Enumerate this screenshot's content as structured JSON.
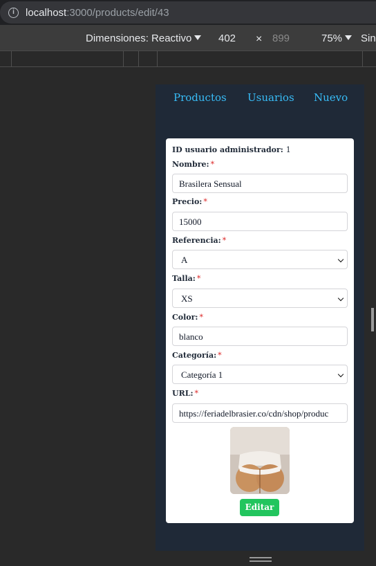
{
  "browser": {
    "url_host": "localhost",
    "url_rest": ":3000/products/edit/43"
  },
  "device_toolbar": {
    "dimensions_label": "Dimensiones: Reactivo",
    "width": "402",
    "times": "×",
    "height": "899",
    "zoom": "75%",
    "throttle": "Sin"
  },
  "nav": {
    "items": [
      "Productos",
      "Usuarios",
      "Nuevo"
    ]
  },
  "form": {
    "admin_label": "ID usuario administrador:",
    "admin_value": "1",
    "required_mark": "*",
    "fields": [
      {
        "label": "Nombre:",
        "value": "Brasilera Sensual"
      },
      {
        "label": "Precio:",
        "value": "15000"
      },
      {
        "label": "Referencia:",
        "value": "A"
      },
      {
        "label": "Talla:",
        "value": "XS"
      },
      {
        "label": "Color:",
        "value": "blanco"
      },
      {
        "label": "Categoría:",
        "value": "Categoría 1"
      },
      {
        "label": "URL:",
        "value": "https://feriadelbrasier.co/cdn/shop/produc"
      }
    ],
    "submit_label": "Editar"
  },
  "colors": {
    "nav_link": "#38bdf8",
    "submit": "#22c55e",
    "required": "#dc2626",
    "device_bg": "#1f2937"
  }
}
